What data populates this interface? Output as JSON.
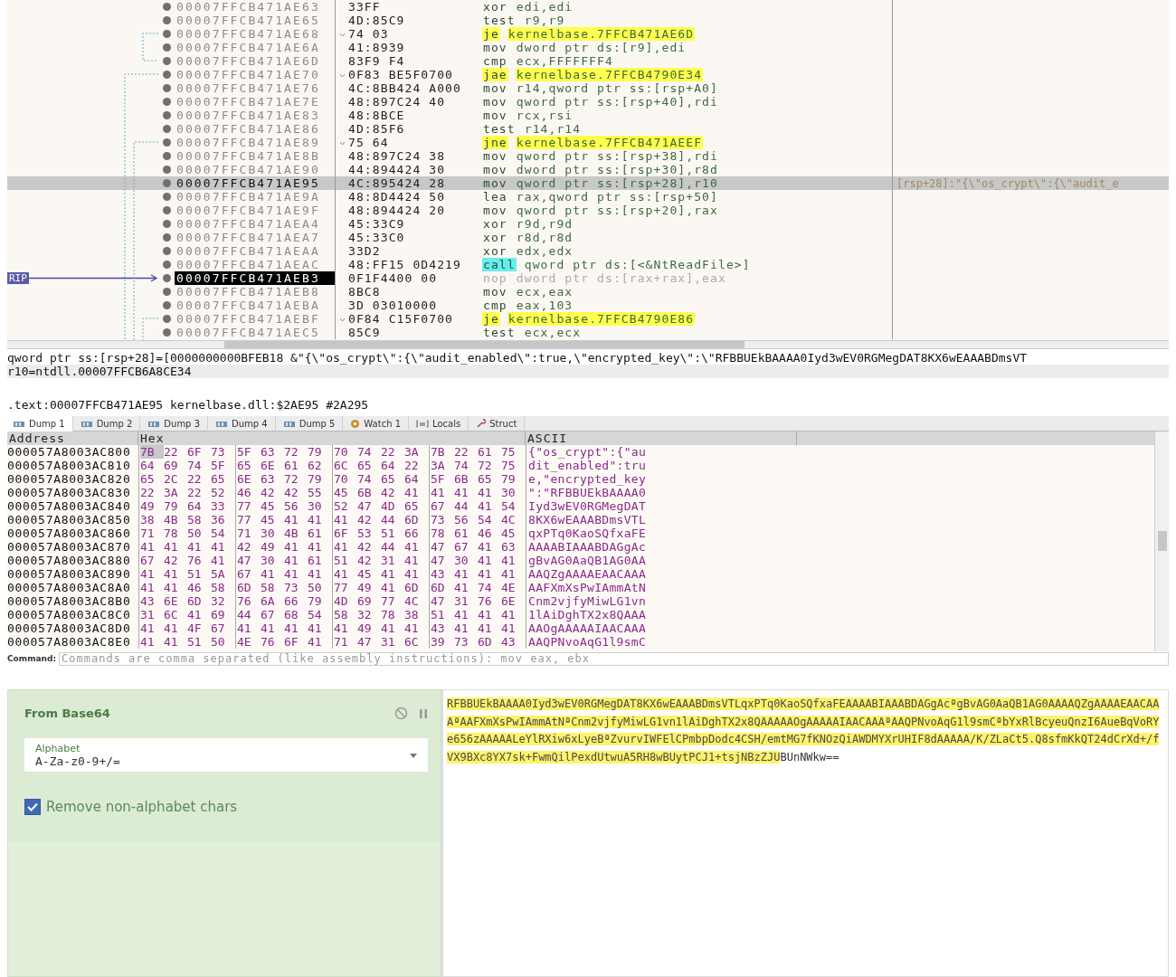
{
  "disassembly": {
    "rip_label": "RIP",
    "rows": [
      {
        "address": "00007FFCB471AE63",
        "bytes": "33FF",
        "mnemonic": "xor",
        "operands": "edi,edi",
        "kind": "plain",
        "branch": false,
        "selected": false,
        "current": false
      },
      {
        "address": "00007FFCB471AE65",
        "bytes": "4D:85C9",
        "mnemonic": "test",
        "operands": "r9,r9",
        "kind": "plain",
        "branch": false,
        "selected": false,
        "current": false
      },
      {
        "address": "00007FFCB471AE68",
        "bytes": "74 03",
        "mnemonic": "je",
        "operands": "kernelbase.7FFCB471AE6D",
        "kind": "jump",
        "branch": true,
        "selected": false,
        "current": false
      },
      {
        "address": "00007FFCB471AE6A",
        "bytes": "41:8939",
        "mnemonic": "mov",
        "operands": "dword ptr ds:[r9],edi",
        "kind": "plain",
        "branch": false,
        "selected": false,
        "current": false
      },
      {
        "address": "00007FFCB471AE6D",
        "bytes": "83F9 F4",
        "mnemonic": "cmp",
        "operands": "ecx,FFFFFFF4",
        "kind": "plain",
        "branch": false,
        "selected": false,
        "current": false
      },
      {
        "address": "00007FFCB471AE70",
        "bytes": "0F83 BE5F0700",
        "mnemonic": "jae",
        "operands": "kernelbase.7FFCB4790E34",
        "kind": "jump",
        "branch": true,
        "selected": false,
        "current": false
      },
      {
        "address": "00007FFCB471AE76",
        "bytes": "4C:8BB424 A000",
        "mnemonic": "mov",
        "operands": "r14,qword ptr ss:[rsp+A0]",
        "kind": "plain",
        "branch": false,
        "selected": false,
        "current": false
      },
      {
        "address": "00007FFCB471AE7E",
        "bytes": "48:897C24 40",
        "mnemonic": "mov",
        "operands": "qword ptr ss:[rsp+40],rdi",
        "kind": "plain",
        "branch": false,
        "selected": false,
        "current": false
      },
      {
        "address": "00007FFCB471AE83",
        "bytes": "48:8BCE",
        "mnemonic": "mov",
        "operands": "rcx,rsi",
        "kind": "plain",
        "branch": false,
        "selected": false,
        "current": false
      },
      {
        "address": "00007FFCB471AE86",
        "bytes": "4D:85F6",
        "mnemonic": "test",
        "operands": "r14,r14",
        "kind": "plain",
        "branch": false,
        "selected": false,
        "current": false
      },
      {
        "address": "00007FFCB471AE89",
        "bytes": "75 64",
        "mnemonic": "jne",
        "operands": "kernelbase.7FFCB471AEEF",
        "kind": "jump",
        "branch": true,
        "selected": false,
        "current": false
      },
      {
        "address": "00007FFCB471AE8B",
        "bytes": "48:897C24 38",
        "mnemonic": "mov",
        "operands": "qword ptr ss:[rsp+38],rdi",
        "kind": "plain",
        "branch": false,
        "selected": false,
        "current": false
      },
      {
        "address": "00007FFCB471AE90",
        "bytes": "44:894424 30",
        "mnemonic": "mov",
        "operands": "dword ptr ss:[rsp+30],r8d",
        "kind": "plain",
        "branch": false,
        "selected": false,
        "current": false
      },
      {
        "address": "00007FFCB471AE95",
        "bytes": "4C:895424 28",
        "mnemonic": "mov",
        "operands": "qword ptr ss:[rsp+28],r10",
        "kind": "plain",
        "branch": false,
        "selected": true,
        "current": false,
        "comment": "[rsp+28]:\"{\\\"os_crypt\\\":{\\\"audit_e"
      },
      {
        "address": "00007FFCB471AE9A",
        "bytes": "48:8D4424 50",
        "mnemonic": "lea",
        "operands": "rax,qword ptr ss:[rsp+50]",
        "kind": "plain",
        "branch": false,
        "selected": false,
        "current": false
      },
      {
        "address": "00007FFCB471AE9F",
        "bytes": "48:894424 20",
        "mnemonic": "mov",
        "operands": "qword ptr ss:[rsp+20],rax",
        "kind": "plain",
        "branch": false,
        "selected": false,
        "current": false
      },
      {
        "address": "00007FFCB471AEA4",
        "bytes": "45:33C9",
        "mnemonic": "xor",
        "operands": "r9d,r9d",
        "kind": "plain",
        "branch": false,
        "selected": false,
        "current": false
      },
      {
        "address": "00007FFCB471AEA7",
        "bytes": "45:33C0",
        "mnemonic": "xor",
        "operands": "r8d,r8d",
        "kind": "plain",
        "branch": false,
        "selected": false,
        "current": false
      },
      {
        "address": "00007FFCB471AEAA",
        "bytes": "33D2",
        "mnemonic": "xor",
        "operands": "edx,edx",
        "kind": "plain",
        "branch": false,
        "selected": false,
        "current": false
      },
      {
        "address": "00007FFCB471AEAC",
        "bytes": "48:FF15 0D4219",
        "mnemonic": "call",
        "operands": "qword ptr ds:[<&NtReadFile>]",
        "kind": "call",
        "branch": false,
        "selected": false,
        "current": false
      },
      {
        "address": "00007FFCB471AEB3",
        "bytes": "0F1F4400 00",
        "mnemonic": "nop",
        "operands": "dword ptr ds:[rax+rax],eax",
        "kind": "nop",
        "branch": false,
        "selected": false,
        "current": true
      },
      {
        "address": "00007FFCB471AEB8",
        "bytes": "8BC8",
        "mnemonic": "mov",
        "operands": "ecx,eax",
        "kind": "plain",
        "branch": false,
        "selected": false,
        "current": false
      },
      {
        "address": "00007FFCB471AEBA",
        "bytes": "3D 03010000",
        "mnemonic": "cmp",
        "operands": "eax,103",
        "kind": "plain",
        "branch": false,
        "selected": false,
        "current": false
      },
      {
        "address": "00007FFCB471AEBF",
        "bytes": "0F84 C15F0700",
        "mnemonic": "je",
        "operands": "kernelbase.7FFCB4790E86",
        "kind": "jump",
        "branch": true,
        "selected": false,
        "current": false
      },
      {
        "address": "00007FFCB471AEC5",
        "bytes": "85C9",
        "mnemonic": "test",
        "operands": "ecx,ecx",
        "kind": "plain",
        "branch": false,
        "selected": false,
        "current": false
      }
    ]
  },
  "info_lines": [
    "qword ptr ss:[rsp+28]=[0000000000BFEB18 &\"{\\\"os_crypt\\\":{\\\"audit_enabled\\\":true,\\\"encrypted_key\\\":\\\"RFBBUEkBAAAA0Iyd3wEV0RGMegDAT8KX6wEAAABDmsVT",
    "r10=ntdll.00007FFCB6A8CE34"
  ],
  "location": ".text:00007FFCB471AE95 kernelbase.dll:$2AE95 #2A295",
  "tabs": [
    {
      "label": "Dump 1",
      "kind": "dump",
      "selected": true
    },
    {
      "label": "Dump 2",
      "kind": "dump",
      "selected": false
    },
    {
      "label": "Dump 3",
      "kind": "dump",
      "selected": false
    },
    {
      "label": "Dump 4",
      "kind": "dump",
      "selected": false
    },
    {
      "label": "Dump 5",
      "kind": "dump",
      "selected": false
    },
    {
      "label": "Watch 1",
      "kind": "watch",
      "selected": false
    },
    {
      "label": "Locals",
      "kind": "locals",
      "selected": false
    },
    {
      "label": "Struct",
      "kind": "struct",
      "selected": false
    }
  ],
  "dump": {
    "columns": [
      "Address",
      "Hex",
      "ASCII"
    ],
    "rows": [
      {
        "address": "000057A8003AC800",
        "hex": [
          "7B 22 6F 73",
          "5F 63 72 79",
          "70 74 22 3A",
          "7B 22 61 75"
        ],
        "ascii": "{\"os_crypt\":{\"au",
        "cursor": true
      },
      {
        "address": "000057A8003AC810",
        "hex": [
          "64 69 74 5F",
          "65 6E 61 62",
          "6C 65 64 22",
          "3A 74 72 75"
        ],
        "ascii": "dit_enabled\":tru",
        "cursor": false
      },
      {
        "address": "000057A8003AC820",
        "hex": [
          "65 2C 22 65",
          "6E 63 72 79",
          "70 74 65 64",
          "5F 6B 65 79"
        ],
        "ascii": "e,\"encrypted_key",
        "cursor": false
      },
      {
        "address": "000057A8003AC830",
        "hex": [
          "22 3A 22 52",
          "46 42 42 55",
          "45 6B 42 41",
          "41 41 41 30"
        ],
        "ascii": "\":\"RFBBUEkBAAAA0",
        "cursor": false
      },
      {
        "address": "000057A8003AC840",
        "hex": [
          "49 79 64 33",
          "77 45 56 30",
          "52 47 4D 65",
          "67 44 41 54"
        ],
        "ascii": "Iyd3wEV0RGMegDAT",
        "cursor": false
      },
      {
        "address": "000057A8003AC850",
        "hex": [
          "38 4B 58 36",
          "77 45 41 41",
          "41 42 44 6D",
          "73 56 54 4C"
        ],
        "ascii": "8KX6wEAAABDmsVTL",
        "cursor": false
      },
      {
        "address": "000057A8003AC860",
        "hex": [
          "71 78 50 54",
          "71 30 4B 61",
          "6F 53 51 66",
          "78 61 46 45"
        ],
        "ascii": "qxPTq0KaoSQfxaFE",
        "cursor": false
      },
      {
        "address": "000057A8003AC870",
        "hex": [
          "41 41 41 41",
          "42 49 41 41",
          "41 42 44 41",
          "47 67 41 63"
        ],
        "ascii": "AAAABIAAABDAGgAc",
        "cursor": false
      },
      {
        "address": "000057A8003AC880",
        "hex": [
          "67 42 76 41",
          "47 30 41 61",
          "51 42 31 41",
          "47 30 41 41"
        ],
        "ascii": "gBvAG0AaQB1AG0AA",
        "cursor": false
      },
      {
        "address": "000057A8003AC890",
        "hex": [
          "41 41 51 5A",
          "67 41 41 41",
          "41 45 41 41",
          "43 41 41 41"
        ],
        "ascii": "AAQZgAAAAEAACAAA",
        "cursor": false
      },
      {
        "address": "000057A8003AC8A0",
        "hex": [
          "41 41 46 58",
          "6D 58 73 50",
          "77 49 41 6D",
          "6D 41 74 4E"
        ],
        "ascii": "AAFXmXsPwIAmmAtN",
        "cursor": false
      },
      {
        "address": "000057A8003AC8B0",
        "hex": [
          "43 6E 6D 32",
          "76 6A 66 79",
          "4D 69 77 4C",
          "47 31 76 6E"
        ],
        "ascii": "Cnm2vjfyMiwLG1vn",
        "cursor": false
      },
      {
        "address": "000057A8003AC8C0",
        "hex": [
          "31 6C 41 69",
          "44 67 68 54",
          "58 32 78 38",
          "51 41 41 41"
        ],
        "ascii": "1lAiDghTX2x8QAAA",
        "cursor": false
      },
      {
        "address": "000057A8003AC8D0",
        "hex": [
          "41 41 4F 67",
          "41 41 41 41",
          "41 49 41 41",
          "43 41 41 41"
        ],
        "ascii": "AAOgAAAAAIAACAAA",
        "cursor": false
      },
      {
        "address": "000057A8003AC8E0",
        "hex": [
          "41 41 51 50",
          "4E 76 6F 41",
          "71 47 31 6C",
          "39 73 6D 43"
        ],
        "ascii": "AAQPNvoAqG1l9smC",
        "cursor": false
      }
    ]
  },
  "command": {
    "label": "Command:",
    "placeholder": "Commands are comma separated (like assembly instructions): mov eax, ebx"
  },
  "recipe": {
    "operation": "From Base64",
    "field": {
      "label": "Alphabet",
      "value": "A-Za-z0-9+/="
    },
    "checkbox": {
      "label": "Remove non-alphabet chars",
      "checked": true
    }
  },
  "output": {
    "highlighted": "RFBBUEkBAAAA0Iyd3wEV0RGMegDAT8KX6wEAAABDmsVTLqxPTq0KaoSQfxaFEAAAABIAAABDAGgAcªgBvAG0AaQB1AG0AAAAQZgAAAAEAACAAAªAAFXmXsPwIAmmAtNªCnm2vjfyMiwLG1vn1lAiDghTX2x8QAAAAAOgAAAAAIAACAAAªAAQPNvoAqG1l9smCªbYxRlBcyeuQnzI6AueBqVoRYe656zAAAAALeYlRXiw6xLyeBªZvurvIWFElCPmbpDodc4CSH/emtMG7fKNOzQiAWDMYXrUHIF8dAAAAA/K/ZLaCt5.Q8sfmKkQT24dCrXd+/fVX9BXc8YX7sk+FwmQilPexdUtwuA5RH8wBUytPCJ1+tsjNBzZJU",
    "rest": "BUnNWkw=="
  }
}
